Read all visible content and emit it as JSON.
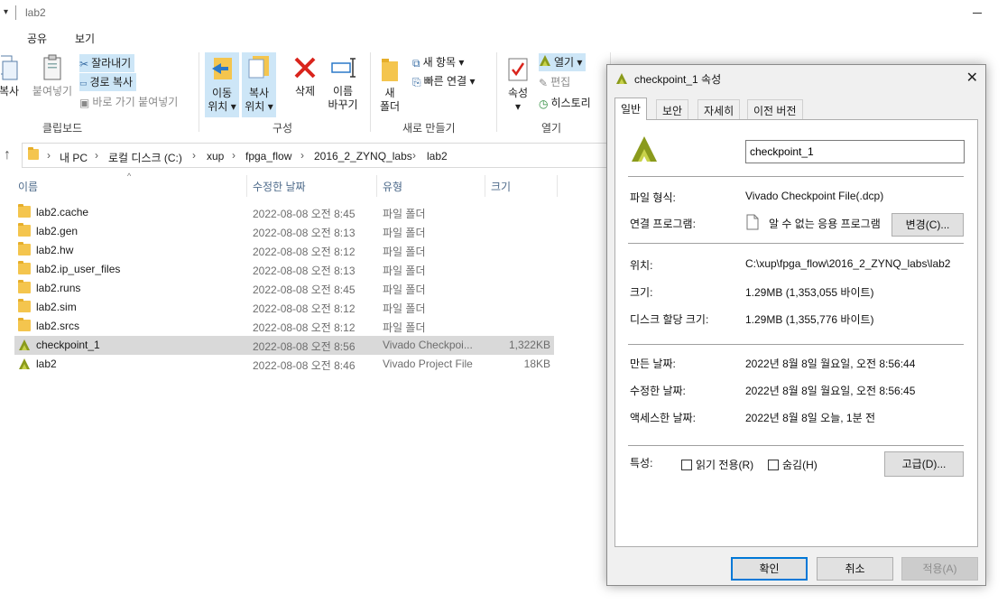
{
  "window": {
    "title": "lab2",
    "tabs": [
      "공유",
      "보기"
    ]
  },
  "ribbon": {
    "clipboard": {
      "copy": "복사",
      "paste": "붙여넣기",
      "cut": "잘라내기",
      "copy_path": "경로 복사",
      "paste_shortcut": "바로 가기 붙여넣기",
      "group_label": "클립보드"
    },
    "organize": {
      "move_to_1": "이동",
      "move_to_2": "위치",
      "copy_to_1": "복사",
      "copy_to_2": "위치",
      "delete": "삭제",
      "rename_1": "이름",
      "rename_2": "바꾸기",
      "group_label": "구성"
    },
    "new": {
      "new_folder_1": "새",
      "new_folder_2": "폴더",
      "new_item": "새 항목",
      "easy_access": "빠른 연결",
      "group_label": "새로 만들기"
    },
    "open": {
      "properties": "속성",
      "open": "열기",
      "edit": "편집",
      "history": "히스토리",
      "group_label": "열기"
    }
  },
  "address_bar": {
    "crumbs": [
      "내 PC",
      "로컬 디스크 (C:)",
      "xup",
      "fpga_flow",
      "2016_2_ZYNQ_labs",
      "lab2"
    ]
  },
  "columns": {
    "name": "이름",
    "modified": "수정한 날짜",
    "type": "유형",
    "size": "크기"
  },
  "files": [
    {
      "name": "lab2.cache",
      "modified": "2022-08-08 오전 8:45",
      "type": "파일 폴더",
      "size": "",
      "icon": "folder-icon"
    },
    {
      "name": "lab2.gen",
      "modified": "2022-08-08 오전 8:13",
      "type": "파일 폴더",
      "size": "",
      "icon": "folder-icon"
    },
    {
      "name": "lab2.hw",
      "modified": "2022-08-08 오전 8:12",
      "type": "파일 폴더",
      "size": "",
      "icon": "folder-icon"
    },
    {
      "name": "lab2.ip_user_files",
      "modified": "2022-08-08 오전 8:13",
      "type": "파일 폴더",
      "size": "",
      "icon": "folder-icon"
    },
    {
      "name": "lab2.runs",
      "modified": "2022-08-08 오전 8:45",
      "type": "파일 폴더",
      "size": "",
      "icon": "folder-icon"
    },
    {
      "name": "lab2.sim",
      "modified": "2022-08-08 오전 8:12",
      "type": "파일 폴더",
      "size": "",
      "icon": "folder-icon"
    },
    {
      "name": "lab2.srcs",
      "modified": "2022-08-08 오전 8:12",
      "type": "파일 폴더",
      "size": "",
      "icon": "folder-icon"
    },
    {
      "name": "checkpoint_1",
      "modified": "2022-08-08 오전 8:56",
      "type": "Vivado Checkpoi...",
      "size": "1,322KB",
      "icon": "vivado-icon",
      "selected": true
    },
    {
      "name": "lab2",
      "modified": "2022-08-08 오전 8:46",
      "type": "Vivado Project File",
      "size": "18KB",
      "icon": "vivado-icon"
    }
  ],
  "dialog": {
    "title": "checkpoint_1 속성",
    "tabs": [
      "일반",
      "보안",
      "자세히",
      "이전 버전"
    ],
    "file_name": "checkpoint_1",
    "file_type_label": "파일 형식:",
    "file_type": "Vivado Checkpoint File(.dcp)",
    "opens_with_label": "연결 프로그램:",
    "opens_with": "알 수 없는 응용 프로그램",
    "change_button": "변경(C)...",
    "location_label": "위치:",
    "location": "C:\\xup\\fpga_flow\\2016_2_ZYNQ_labs\\lab2",
    "size_label": "크기:",
    "size": "1.29MB (1,353,055 바이트)",
    "size_on_disk_label": "디스크 할당 크기:",
    "size_on_disk": "1.29MB (1,355,776 바이트)",
    "created_label": "만든 날짜:",
    "created": "2022년 8월 8일 월요일, 오전 8:56:44",
    "modified_label": "수정한 날짜:",
    "modified": "2022년 8월 8일 월요일, 오전 8:56:45",
    "accessed_label": "액세스한 날짜:",
    "accessed": "2022년 8월 8일 오늘, 1분 전",
    "attributes_label": "특성:",
    "readonly": "읽기 전용(R)",
    "hidden": "숨김(H)",
    "advanced_button": "고급(D)...",
    "ok": "확인",
    "cancel": "취소",
    "apply": "적용(A)"
  },
  "colors": {
    "selection": "#d9d9d9",
    "accent": "#0078d7",
    "folder": "#f4c54e",
    "vivado": "#8a9a1c"
  }
}
